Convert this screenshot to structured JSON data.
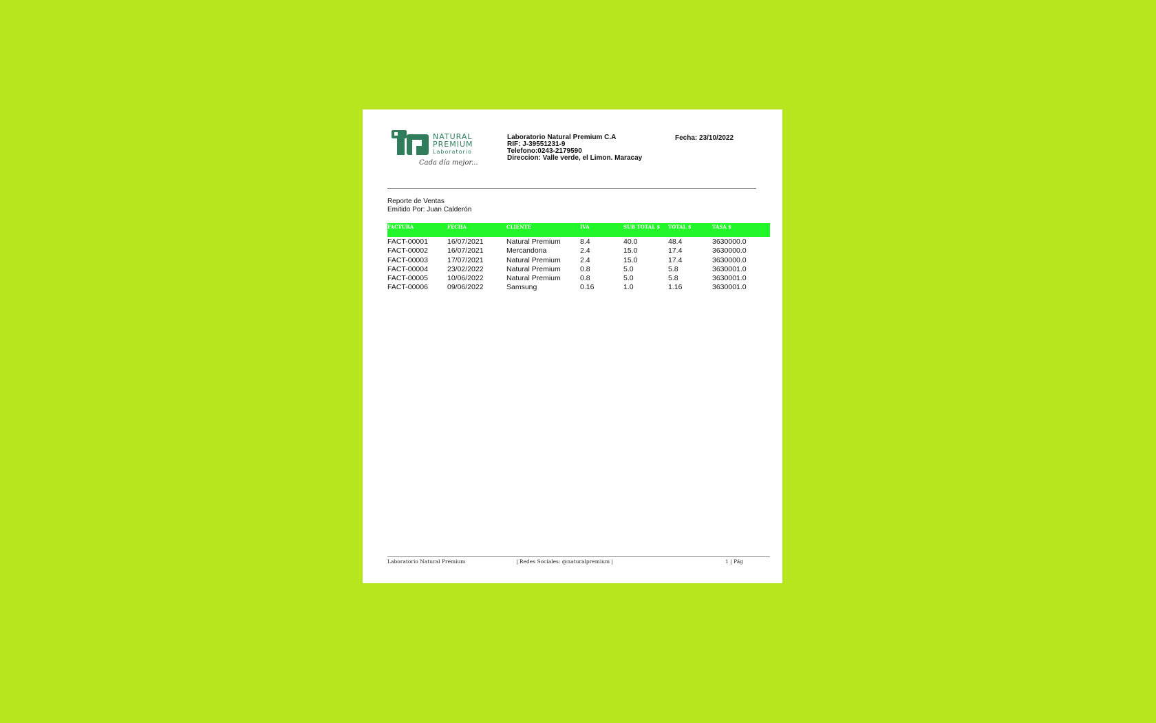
{
  "logo": {
    "line1": "NATURAL",
    "line2": "PREMIUM",
    "line3": "Laboratorio",
    "tagline": "Cada día mejor...",
    "colors": {
      "dark": "#2f7d5a",
      "light": "#ffffff"
    }
  },
  "company": {
    "name": "Laboratorio Natural Premium C.A",
    "rif": "RIF: J-39551231-9",
    "phone": "Telefono:0243-2179590",
    "address": "Direccion: Valle verde, el Limon. Maracay"
  },
  "report_date": "Fecha: 23/10/2022",
  "report": {
    "title": "Reporte de Ventas",
    "issued_by": "Emitido Por: Juan Calderón"
  },
  "table": {
    "header_color": "#22f52a",
    "columns": [
      "FACTURA",
      "FECHA",
      "CLIENTE",
      "IVA",
      "SUB TOTAL $",
      "TOTAL $",
      "TASA $"
    ],
    "rows": [
      [
        "FACT-00001",
        "16/07/2021",
        "Natural Premium",
        "8.4",
        "40.0",
        "48.4",
        "3630000.0"
      ],
      [
        "FACT-00002",
        "16/07/2021",
        "Mercandona",
        "2.4",
        "15.0",
        "17.4",
        "3630000.0"
      ],
      [
        "FACT-00003",
        "17/07/2021",
        "Natural Premium",
        "2.4",
        "15.0",
        "17.4",
        "3630000.0"
      ],
      [
        "FACT-00004",
        "23/02/2022",
        "Natural Premium",
        "0.8",
        "5.0",
        "5.8",
        "3630001.0"
      ],
      [
        "FACT-00005",
        "10/06/2022",
        "Natural Premium",
        "0.8",
        "5.0",
        "5.8",
        "3630001.0"
      ],
      [
        "FACT-00006",
        "09/06/2022",
        "Samsung",
        "0.16",
        "1.0",
        "1.16",
        "3630001.0"
      ]
    ]
  },
  "footer": {
    "left": "Laboratorio Natural Premium",
    "middle": "|    Redes Sociales: @naturalpremium    |",
    "right": "1 | Pág"
  }
}
